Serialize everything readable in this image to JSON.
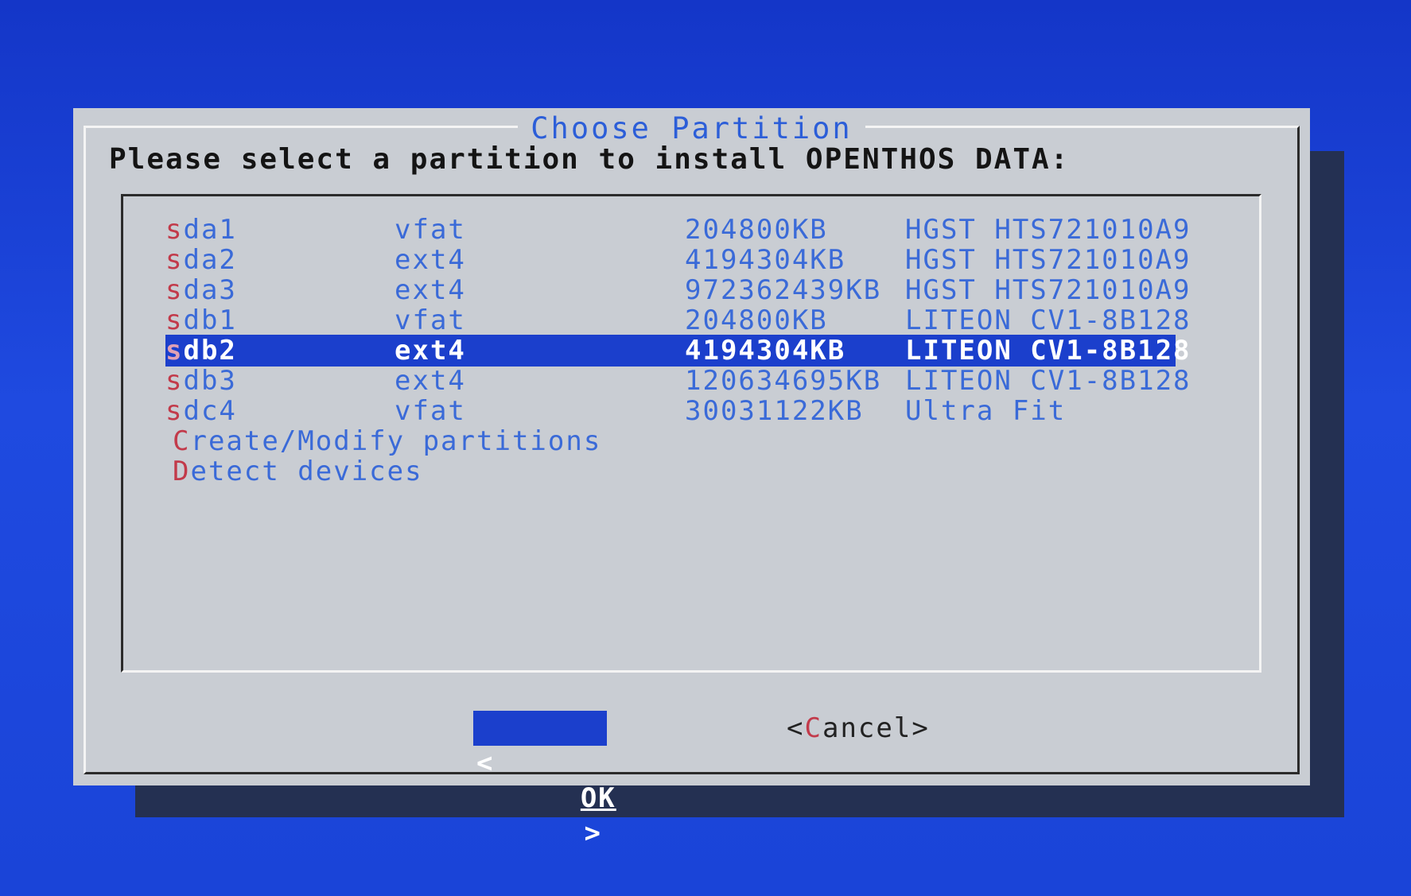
{
  "dialog": {
    "title": "Choose Partition",
    "prompt": "Please select a partition to install OPENTHOS DATA:"
  },
  "partitions": [
    {
      "name_first": "s",
      "name_rest": "da1",
      "fs": "vfat",
      "size": "204800KB",
      "model": "HGST HTS721010A9",
      "selected": false
    },
    {
      "name_first": "s",
      "name_rest": "da2",
      "fs": "ext4",
      "size": "4194304KB",
      "model": "HGST HTS721010A9",
      "selected": false
    },
    {
      "name_first": "s",
      "name_rest": "da3",
      "fs": "ext4",
      "size": "972362439KB",
      "model": "HGST HTS721010A9",
      "selected": false
    },
    {
      "name_first": "s",
      "name_rest": "db1",
      "fs": "vfat",
      "size": "204800KB",
      "model": "LITEON CV1-8B128",
      "selected": false
    },
    {
      "name_first": "s",
      "name_rest": "db2",
      "fs": "ext4",
      "size": "4194304KB",
      "model": "LITEON CV1-8B128",
      "selected": true
    },
    {
      "name_first": "s",
      "name_rest": "db3",
      "fs": "ext4",
      "size": "120634695KB",
      "model": "LITEON CV1-8B128",
      "selected": false
    },
    {
      "name_first": "s",
      "name_rest": "dc4",
      "fs": "vfat",
      "size": "30031122KB",
      "model": "Ultra Fit",
      "selected": false
    }
  ],
  "actions": [
    {
      "first": "C",
      "rest": "reate/Modify partitions"
    },
    {
      "first": "D",
      "rest": "etect devices"
    }
  ],
  "buttons": {
    "ok_left": "<",
    "ok_label": "OK",
    "ok_right": ">",
    "cancel_open": "<",
    "cancel_hot": "C",
    "cancel_rest": "ancel>"
  },
  "colors": {
    "background": "#1a3fd0",
    "dialog": "#c9cdd3",
    "highlight": "#1b3fcc",
    "hotkey": "#c23a4a",
    "item_text": "#3a6ad8"
  }
}
